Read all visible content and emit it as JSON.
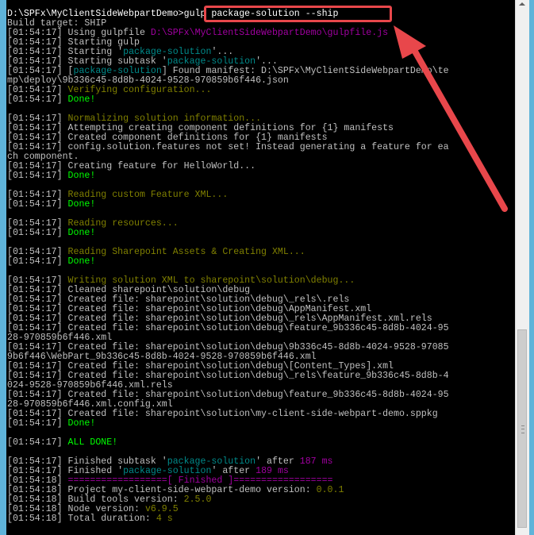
{
  "console": {
    "lines": [
      [
        [
          "D:\\SPFx\\MyClientSideWebpartDemo>gulp package-solution --ship",
          "w"
        ]
      ],
      [
        [
          "Build target: SHIP",
          "g"
        ]
      ],
      [
        [
          "[01:54:17] Using gulpfile ",
          "g"
        ],
        [
          "D:\\SPFx\\MyClientSideWebpartDemo\\gulpfile.js",
          "m"
        ]
      ],
      [
        [
          "[01:54:17] Starting gulp",
          "g"
        ]
      ],
      [
        [
          "[01:54:17] Starting '",
          "g"
        ],
        [
          "package-solution",
          "c"
        ],
        [
          "'...",
          "g"
        ]
      ],
      [
        [
          "[01:54:17] Starting subtask '",
          "g"
        ],
        [
          "package-solution",
          "c"
        ],
        [
          "'...",
          "g"
        ]
      ],
      [
        [
          "[01:54:17] [",
          "g"
        ],
        [
          "package-solution",
          "c"
        ],
        [
          "] Found manifest: D:\\SPFx\\MyClientSideWebpartDemo\\te",
          "g"
        ]
      ],
      [
        [
          "mp\\deploy\\9b336c45-8d8b-4024-9528-970859b6f446.json",
          "g"
        ]
      ],
      [
        [
          "[01:54:17] ",
          "g"
        ],
        [
          "Verifying configuration...",
          "y"
        ]
      ],
      [
        [
          "[01:54:17] ",
          "g"
        ],
        [
          "Done!",
          "lg"
        ]
      ],
      [
        [
          "",
          "g"
        ]
      ],
      [
        [
          "[01:54:17] ",
          "g"
        ],
        [
          "Normalizing solution information...",
          "y"
        ]
      ],
      [
        [
          "[01:54:17] Attempting creating component definitions for {1} manifests",
          "g"
        ]
      ],
      [
        [
          "[01:54:17] Created component definitions for {1} manifests",
          "g"
        ]
      ],
      [
        [
          "[01:54:17] config.solution.features not set! Instead generating a feature for ea",
          "g"
        ]
      ],
      [
        [
          "ch component.",
          "g"
        ]
      ],
      [
        [
          "[01:54:17] Creating feature for HelloWorld...",
          "g"
        ]
      ],
      [
        [
          "[01:54:17] ",
          "g"
        ],
        [
          "Done!",
          "lg"
        ]
      ],
      [
        [
          "",
          "g"
        ]
      ],
      [
        [
          "[01:54:17] ",
          "g"
        ],
        [
          "Reading custom Feature XML...",
          "y"
        ]
      ],
      [
        [
          "[01:54:17] ",
          "g"
        ],
        [
          "Done!",
          "lg"
        ]
      ],
      [
        [
          "",
          "g"
        ]
      ],
      [
        [
          "[01:54:17] ",
          "g"
        ],
        [
          "Reading resources...",
          "y"
        ]
      ],
      [
        [
          "[01:54:17] ",
          "g"
        ],
        [
          "Done!",
          "lg"
        ]
      ],
      [
        [
          "",
          "g"
        ]
      ],
      [
        [
          "[01:54:17] ",
          "g"
        ],
        [
          "Reading Sharepoint Assets & Creating XML...",
          "y"
        ]
      ],
      [
        [
          "[01:54:17] ",
          "g"
        ],
        [
          "Done!",
          "lg"
        ]
      ],
      [
        [
          "",
          "g"
        ]
      ],
      [
        [
          "[01:54:17] ",
          "g"
        ],
        [
          "Writing solution XML to sharepoint\\solution\\debug...",
          "y"
        ]
      ],
      [
        [
          "[01:54:17] Cleaned sharepoint\\solution\\debug",
          "g"
        ]
      ],
      [
        [
          "[01:54:17] Created file: sharepoint\\solution\\debug\\_rels\\.rels",
          "g"
        ]
      ],
      [
        [
          "[01:54:17] Created file: sharepoint\\solution\\debug\\AppManifest.xml",
          "g"
        ]
      ],
      [
        [
          "[01:54:17] Created file: sharepoint\\solution\\debug\\_rels\\AppManifest.xml.rels",
          "g"
        ]
      ],
      [
        [
          "[01:54:17] Created file: sharepoint\\solution\\debug\\feature_9b336c45-8d8b-4024-95",
          "g"
        ]
      ],
      [
        [
          "28-970859b6f446.xml",
          "g"
        ]
      ],
      [
        [
          "[01:54:17] Created file: sharepoint\\solution\\debug\\9b336c45-8d8b-4024-9528-97085",
          "g"
        ]
      ],
      [
        [
          "9b6f446\\WebPart_9b336c45-8d8b-4024-9528-970859b6f446.xml",
          "g"
        ]
      ],
      [
        [
          "[01:54:17] Created file: sharepoint\\solution\\debug\\[Content_Types].xml",
          "g"
        ]
      ],
      [
        [
          "[01:54:17] Created file: sharepoint\\solution\\debug\\_rels\\feature_9b336c45-8d8b-4",
          "g"
        ]
      ],
      [
        [
          "024-9528-970859b6f446.xml.rels",
          "g"
        ]
      ],
      [
        [
          "[01:54:17] Created file: sharepoint\\solution\\debug\\feature_9b336c45-8d8b-4024-95",
          "g"
        ]
      ],
      [
        [
          "28-970859b6f446.xml.config.xml",
          "g"
        ]
      ],
      [
        [
          "[01:54:17] Created file: sharepoint\\solution\\my-client-side-webpart-demo.sppkg",
          "g"
        ]
      ],
      [
        [
          "[01:54:17] ",
          "g"
        ],
        [
          "Done!",
          "lg"
        ]
      ],
      [
        [
          "",
          "g"
        ]
      ],
      [
        [
          "[01:54:17] ",
          "g"
        ],
        [
          "ALL DONE!",
          "lg"
        ]
      ],
      [
        [
          "",
          "g"
        ]
      ],
      [
        [
          "[01:54:17] Finished subtask '",
          "g"
        ],
        [
          "package-solution",
          "c"
        ],
        [
          "' after ",
          "g"
        ],
        [
          "187 ms",
          "m"
        ]
      ],
      [
        [
          "[01:54:17] Finished '",
          "g"
        ],
        [
          "package-solution",
          "c"
        ],
        [
          "' after ",
          "g"
        ],
        [
          "189 ms",
          "m"
        ]
      ],
      [
        [
          "[01:54:18] ",
          "g"
        ],
        [
          "==================[ Finished ]==================",
          "m"
        ]
      ],
      [
        [
          "[01:54:18] Project my-client-side-webpart-demo version: ",
          "g"
        ],
        [
          "0.0.1",
          "y"
        ]
      ],
      [
        [
          "[01:54:18] Build tools version: ",
          "g"
        ],
        [
          "2.5.0",
          "y"
        ]
      ],
      [
        [
          "[01:54:18] Node version: ",
          "g"
        ],
        [
          "v6.9.5",
          "y"
        ]
      ],
      [
        [
          "[01:54:18] Total duration: ",
          "g"
        ],
        [
          "4 s",
          "y"
        ]
      ]
    ]
  },
  "annotation": {
    "color": "#e8474b"
  }
}
